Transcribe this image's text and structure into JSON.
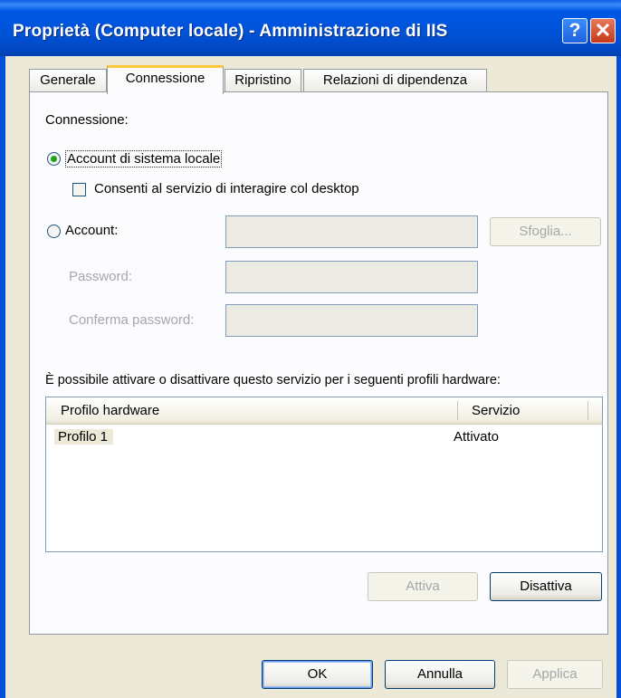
{
  "window": {
    "title": "Proprietà (Computer locale) - Amministrazione di IIS",
    "help_button": "?",
    "close_button": "✕"
  },
  "tabs": [
    {
      "label": "Generale"
    },
    {
      "label": "Connessione"
    },
    {
      "label": "Ripristino"
    },
    {
      "label": "Relazioni di dipendenza"
    }
  ],
  "connection": {
    "section_label": "Connessione:",
    "local_system_account": "Account di sistema locale",
    "allow_desktop_interaction": "Consenti al servizio di interagire col desktop",
    "account_label": "Account:",
    "account_value": "",
    "browse_button": "Sfoglia...",
    "password_label": "Password:",
    "password_value": "",
    "confirm_password_label": "Conferma password:",
    "confirm_password_value": ""
  },
  "hardware": {
    "description": "È possibile attivare o disattivare questo servizio per i seguenti profili hardware:",
    "columns": [
      "Profilo hardware",
      "Servizio"
    ],
    "rows": [
      {
        "profile": "Profilo 1",
        "service": "Attivato"
      }
    ],
    "enable_button": "Attiva",
    "disable_button": "Disattiva"
  },
  "footer": {
    "ok_button": "OK",
    "cancel_button": "Annulla",
    "apply_button": "Applica"
  },
  "state": {
    "selected_tab": "Connessione",
    "selected_radio": "Account di sistema locale",
    "desktop_interaction_checked": false
  },
  "colors": {
    "titlebar": "#0054E3",
    "dialog_bg": "#ECE9D8",
    "active_tab_accent": "#FFC83C",
    "radio_dot": "#21A121",
    "disabled_text": "#A7A6AA"
  }
}
